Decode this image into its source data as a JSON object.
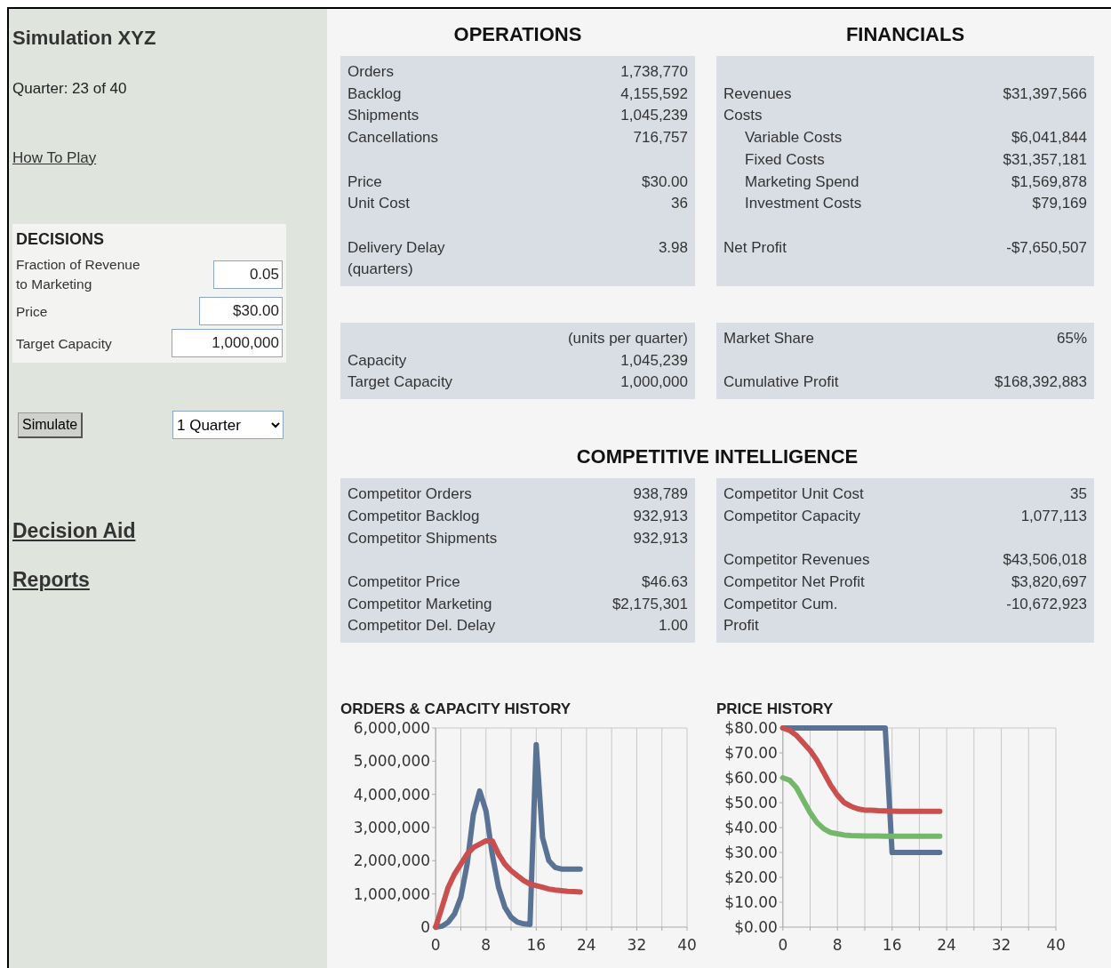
{
  "sidebar": {
    "title": "Simulation XYZ",
    "quarter": "Quarter: 23 of 40",
    "how_to_play": "How To Play",
    "decisions": {
      "heading": "DECISIONS",
      "fields": [
        {
          "label": "Fraction of Revenue\nto Marketing",
          "value": "0.05"
        },
        {
          "label": "Price",
          "value": "$30.00"
        },
        {
          "label": "Target Capacity",
          "value": "1,000,000"
        }
      ]
    },
    "simulate_button": "Simulate",
    "period_select": "1 Quarter",
    "links": [
      "Decision Aid",
      "Reports"
    ]
  },
  "operations": {
    "heading": "OPERATIONS",
    "panels": [
      {
        "groups": [
          [
            {
              "label": "Orders",
              "value": "1,738,770"
            },
            {
              "label": "Backlog",
              "value": "4,155,592"
            },
            {
              "label": "Shipments",
              "value": "1,045,239"
            },
            {
              "label": "Cancellations",
              "value": "716,757"
            }
          ],
          [
            {
              "label": "Price",
              "value": "$30.00"
            },
            {
              "label": "Unit Cost",
              "value": "36"
            }
          ],
          [
            {
              "label": "Delivery Delay\n(quarters)",
              "value": "3.98"
            }
          ]
        ]
      },
      {
        "note": "(units per quarter)",
        "groups": [
          [
            {
              "label": "Capacity",
              "value": "1,045,239"
            },
            {
              "label": "Target Capacity",
              "value": "1,000,000"
            }
          ]
        ]
      }
    ]
  },
  "financials": {
    "heading": "FINANCIALS",
    "panels": [
      {
        "groups": [
          [
            {
              "label": "Revenues",
              "value": "$31,397,566"
            },
            {
              "label": "Costs",
              "children": [
                {
                  "label": "Variable Costs",
                  "value": "$6,041,844"
                },
                {
                  "label": "Fixed Costs",
                  "value": "$31,357,181"
                },
                {
                  "label": "Marketing Spend",
                  "value": "$1,569,878"
                },
                {
                  "label": "Investment Costs",
                  "value": "$79,169"
                }
              ]
            }
          ],
          [
            {
              "label": "Net Profit",
              "value": "-$7,650,507"
            }
          ]
        ]
      },
      {
        "groups": [
          [
            {
              "label": "Market Share",
              "value": "65%"
            }
          ],
          [
            {
              "label": "Cumulative Profit",
              "value": "$168,392,883"
            }
          ]
        ]
      }
    ]
  },
  "competitive": {
    "heading": "COMPETITIVE INTELLIGENCE",
    "panels": [
      {
        "groups": [
          [
            {
              "label": "Competitor Orders",
              "value": "938,789"
            },
            {
              "label": "Competitor Backlog",
              "value": "932,913"
            },
            {
              "label": "Competitor Shipments",
              "value": "932,913"
            }
          ],
          [
            {
              "label": "Competitor Price",
              "value": "$46.63"
            },
            {
              "label": "Competitor Marketing",
              "value": "$2,175,301"
            },
            {
              "label": "Competitor Del. Delay",
              "value": "1.00"
            }
          ]
        ]
      },
      {
        "groups": [
          [
            {
              "label": "Competitor Unit Cost",
              "value": "35"
            },
            {
              "label": "Competitor Capacity",
              "value": "1,077,113"
            }
          ],
          [
            {
              "label": "Competitor Revenues",
              "value": "$43,506,018"
            },
            {
              "label": "Competitor Net Profit",
              "value": "$3,820,697"
            },
            {
              "label": "Competitor Cum.\nProfit",
              "value": "-10,672,923"
            }
          ]
        ]
      }
    ]
  },
  "charts": [
    {
      "chart_data": {
        "type": "line",
        "grid": true,
        "title": "ORDERS & CAPACITY HISTORY",
        "x": [
          0,
          1,
          2,
          3,
          4,
          5,
          6,
          7,
          8,
          9,
          10,
          11,
          12,
          13,
          14,
          15,
          16,
          17,
          18,
          19,
          20,
          21,
          22,
          23
        ],
        "xlim": [
          0,
          40
        ],
        "ylim": [
          0,
          6000000
        ],
        "xticks": [
          0,
          8,
          16,
          24,
          32,
          40
        ],
        "yticks": [
          {
            "value": 0,
            "label": "0"
          },
          {
            "value": 1000000,
            "label": "1,000,000"
          },
          {
            "value": 2000000,
            "label": "2,000,000"
          },
          {
            "value": 3000000,
            "label": "3,000,000"
          },
          {
            "value": 4000000,
            "label": "4,000,000"
          },
          {
            "value": 5000000,
            "label": "5,000,000"
          },
          {
            "value": 6000000,
            "label": "6,000,000"
          }
        ],
        "series": [
          {
            "color": "#5a7394",
            "values": [
              0,
              30000,
              150000,
              400000,
              900000,
              1900000,
              3400000,
              4100000,
              3500000,
              2200000,
              1200000,
              600000,
              300000,
              150000,
              100000,
              80000,
              5500000,
              2700000,
              2000000,
              1800000,
              1750000,
              1750000,
              1750000,
              1750000
            ]
          },
          {
            "color": "#c9504f",
            "values": [
              0,
              600000,
              1200000,
              1600000,
              1900000,
              2200000,
              2400000,
              2500000,
              2600000,
              2600000,
              2200000,
              1900000,
              1700000,
              1550000,
              1400000,
              1300000,
              1250000,
              1200000,
              1150000,
              1120000,
              1100000,
              1080000,
              1070000,
              1060000
            ]
          }
        ]
      }
    },
    {
      "chart_data": {
        "type": "line",
        "grid": true,
        "title": "PRICE HISTORY",
        "x": [
          0,
          1,
          2,
          3,
          4,
          5,
          6,
          7,
          8,
          9,
          10,
          11,
          12,
          13,
          14,
          15,
          16,
          17,
          18,
          19,
          20,
          21,
          22,
          23
        ],
        "xlim": [
          0,
          40
        ],
        "ylim": [
          0,
          80
        ],
        "xticks": [
          0,
          8,
          16,
          24,
          32,
          40
        ],
        "yticks": [
          {
            "value": 0,
            "label": "$0.00"
          },
          {
            "value": 10,
            "label": "$10.00"
          },
          {
            "value": 20,
            "label": "$20.00"
          },
          {
            "value": 30,
            "label": "$30.00"
          },
          {
            "value": 40,
            "label": "$40.00"
          },
          {
            "value": 50,
            "label": "$50.00"
          },
          {
            "value": 60,
            "label": "$60.00"
          },
          {
            "value": 70,
            "label": "$70.00"
          },
          {
            "value": 80,
            "label": "$80.00"
          }
        ],
        "series": [
          {
            "color": "#5a7394",
            "values": [
              80,
              80,
              80,
              80,
              80,
              80,
              80,
              80,
              80,
              80,
              80,
              80,
              80,
              80,
              80,
              80,
              30,
              30,
              30,
              30,
              30,
              30,
              30,
              30
            ]
          },
          {
            "color": "#c9504f",
            "values": [
              80,
              79,
              77,
              74,
              71,
              67,
              62,
              57,
              53,
              50,
              48.5,
              47.5,
              47,
              47,
              46.8,
              46.7,
              46.6,
              46.5,
              46.5,
              46.5,
              46.5,
              46.5,
              46.5,
              46.5
            ]
          },
          {
            "color": "#74b66a",
            "values": [
              60,
              59,
              56,
              51,
              46,
              42,
              39.5,
              38,
              37.5,
              37,
              36.8,
              36.7,
              36.6,
              36.6,
              36.6,
              36.5,
              36.5,
              36.5,
              36.5,
              36.5,
              36.5,
              36.5,
              36.5,
              36.5
            ]
          }
        ]
      }
    }
  ]
}
